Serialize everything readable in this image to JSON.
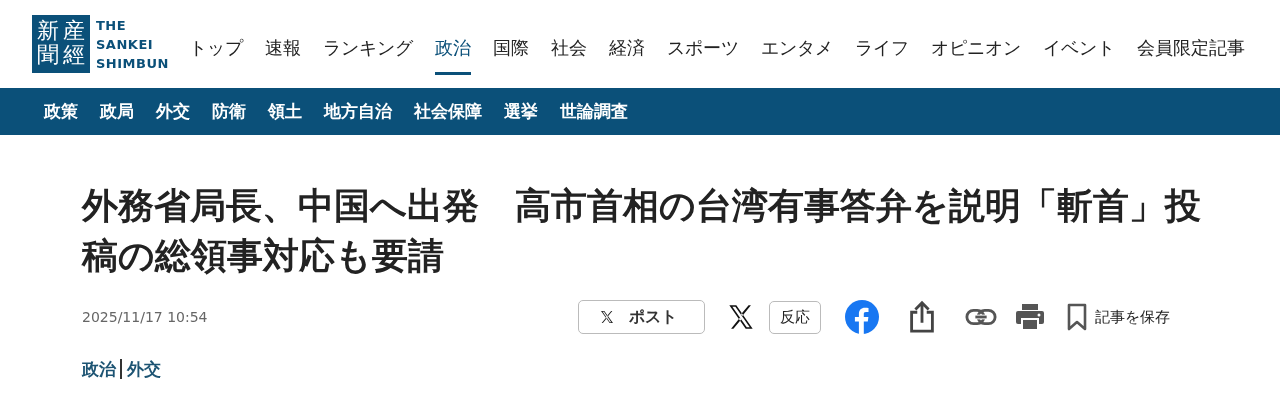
{
  "header": {
    "logo": {
      "seal_columns": [
        "新聞",
        "産經"
      ],
      "wordmark": [
        "THE",
        "SANKEI",
        "SHIMBUN"
      ]
    },
    "nav": [
      {
        "label": "トップ",
        "selected": false
      },
      {
        "label": "速報",
        "selected": false
      },
      {
        "label": "ランキング",
        "selected": false
      },
      {
        "label": "政治",
        "selected": true
      },
      {
        "label": "国際",
        "selected": false
      },
      {
        "label": "社会",
        "selected": false
      },
      {
        "label": "経済",
        "selected": false
      },
      {
        "label": "スポーツ",
        "selected": false
      },
      {
        "label": "エンタメ",
        "selected": false
      },
      {
        "label": "ライフ",
        "selected": false
      },
      {
        "label": "オピニオン",
        "selected": false
      },
      {
        "label": "イベント",
        "selected": false
      },
      {
        "label": "会員限定記事",
        "selected": false
      }
    ]
  },
  "subnav": [
    "政策",
    "政局",
    "外交",
    "防衛",
    "領土",
    "地方自治",
    "社会保障",
    "選挙",
    "世論調査"
  ],
  "article": {
    "headline": "外務省局長、中国へ出発　高市首相の台湾有事答弁を説明「斬首」投稿の総領事対応も要請",
    "date": "2025/11/17 10:54",
    "share": [
      {
        "kind": "post",
        "label": "ポスト"
      },
      {
        "kind": "reaction",
        "label": "反応"
      },
      {
        "kind": "facebook"
      },
      {
        "kind": "share"
      },
      {
        "kind": "link"
      },
      {
        "kind": "print"
      },
      {
        "kind": "save",
        "label": "記事を保存"
      }
    ],
    "categories": [
      "政治",
      "外交"
    ]
  }
}
